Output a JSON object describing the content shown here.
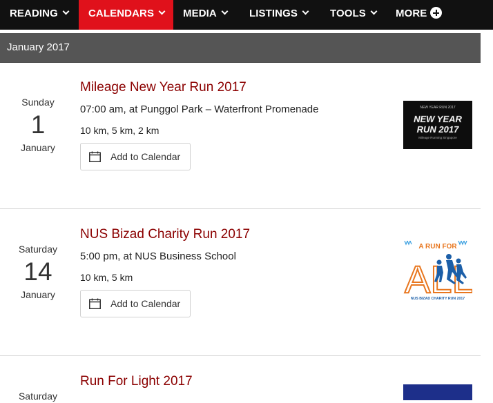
{
  "nav": {
    "items": [
      {
        "label": "READING",
        "dropdown": true,
        "active": false
      },
      {
        "label": "CALENDARS",
        "dropdown": true,
        "active": true
      },
      {
        "label": "MEDIA",
        "dropdown": true,
        "active": false
      },
      {
        "label": "LISTINGS",
        "dropdown": true,
        "active": false
      },
      {
        "label": "TOOLS",
        "dropdown": true,
        "active": false
      },
      {
        "label": "MORE",
        "dropdown": false,
        "active": false,
        "icon": "plus-circle-icon"
      }
    ],
    "colors": {
      "bar": "#111111",
      "active": "#e0111b"
    }
  },
  "month_header": "January 2017",
  "events": [
    {
      "weekday": "Sunday",
      "day": "1",
      "month": "January",
      "title": "Mileage New Year Run 2017",
      "time_location": "07:00 am, at Punggol Park – Waterfront Promenade",
      "distances": "10 km, 5 km, 2 km",
      "add_label": "Add to Calendar",
      "image": {
        "lines": [
          "NEW YEAR",
          "RUN 2017"
        ],
        "small_text": "Mileage Running Singapore"
      }
    },
    {
      "weekday": "Saturday",
      "day": "14",
      "month": "January",
      "title": "NUS Bizad Charity Run 2017",
      "time_location": "5:00 pm, at NUS Business School",
      "distances": "10 km, 5 km",
      "add_label": "Add to Calendar",
      "image": {
        "top": "A RUN FOR",
        "big": "ALL",
        "bottom": "NUS BIZAD CHARITY RUN 2017"
      }
    },
    {
      "weekday": "Saturday",
      "title": "Run For Light 2017"
    }
  ],
  "colors": {
    "title": "#8b0000",
    "month_bar": "#555555"
  }
}
